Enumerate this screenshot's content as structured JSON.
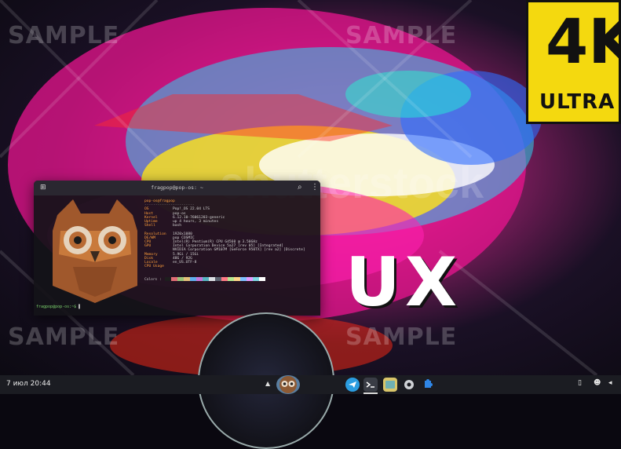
{
  "wallpaper": {
    "watermarks": [
      "SAMPLE",
      "SAMPLE",
      "SAMPLE",
      "SAMPLE"
    ],
    "badge_main": "4K",
    "badge_sub": "ULTRA",
    "brand_text": "UX",
    "faint_text": "shutterstock"
  },
  "terminal": {
    "title": "fragpop@pop-os: ~",
    "user_host": "pop-os@fragpop",
    "separator": "-----------------------",
    "info": [
      {
        "k": "OS",
        "v": "Pop!_OS 22.04 LTS"
      },
      {
        "k": "Host",
        "v": "pop-os"
      },
      {
        "k": "Kernel",
        "v": "6.12.10-76061203-generic"
      },
      {
        "k": "Uptime",
        "v": "up 4 hours, 3 minutes"
      },
      {
        "k": "Shell",
        "v": "bash"
      },
      {
        "k": "",
        "v": ""
      },
      {
        "k": "Resolution",
        "v": "1920x1080"
      },
      {
        "k": "DE/WM",
        "v": "pop COSMIC"
      },
      {
        "k": "CPU",
        "v": "Intel(R) Pentium(R) CPU G4560 @ 3.50GHz"
      },
      {
        "k": "GPU",
        "v": "Intel Corporation Device 5a27 [rev 05] [Integrated]"
      },
      {
        "k": "",
        "v": "NVIDIA Corporation GM107M [GeForce 950TX] [rev a2] [Discrete]"
      },
      {
        "k": "Memory",
        "v": "5.9Gi / 15Gi"
      },
      {
        "k": "Disk",
        "v": "48G / 92G"
      },
      {
        "k": "Locale",
        "v": "en_US.UTF-8"
      },
      {
        "k": "CPU Usage",
        "v": ""
      }
    ],
    "colors_label": "Colors :",
    "swatches": [
      "#1e1e1e",
      "#e06c75",
      "#98c379",
      "#e5c07b",
      "#61afef",
      "#c678dd",
      "#56b6c2",
      "#dcdfe4",
      "#5c6370",
      "#ff7a85",
      "#b5e890",
      "#ffd58a",
      "#7fc1ff",
      "#e39bff",
      "#7fd9e3",
      "#ffffff"
    ],
    "prompt": "fragpop@pop-os:~$"
  },
  "taskbar": {
    "clock": "7 июл 20:44"
  },
  "icons": {
    "new_tab": "new-tab-icon",
    "search": "search-icon",
    "menu": "menu-icon"
  }
}
